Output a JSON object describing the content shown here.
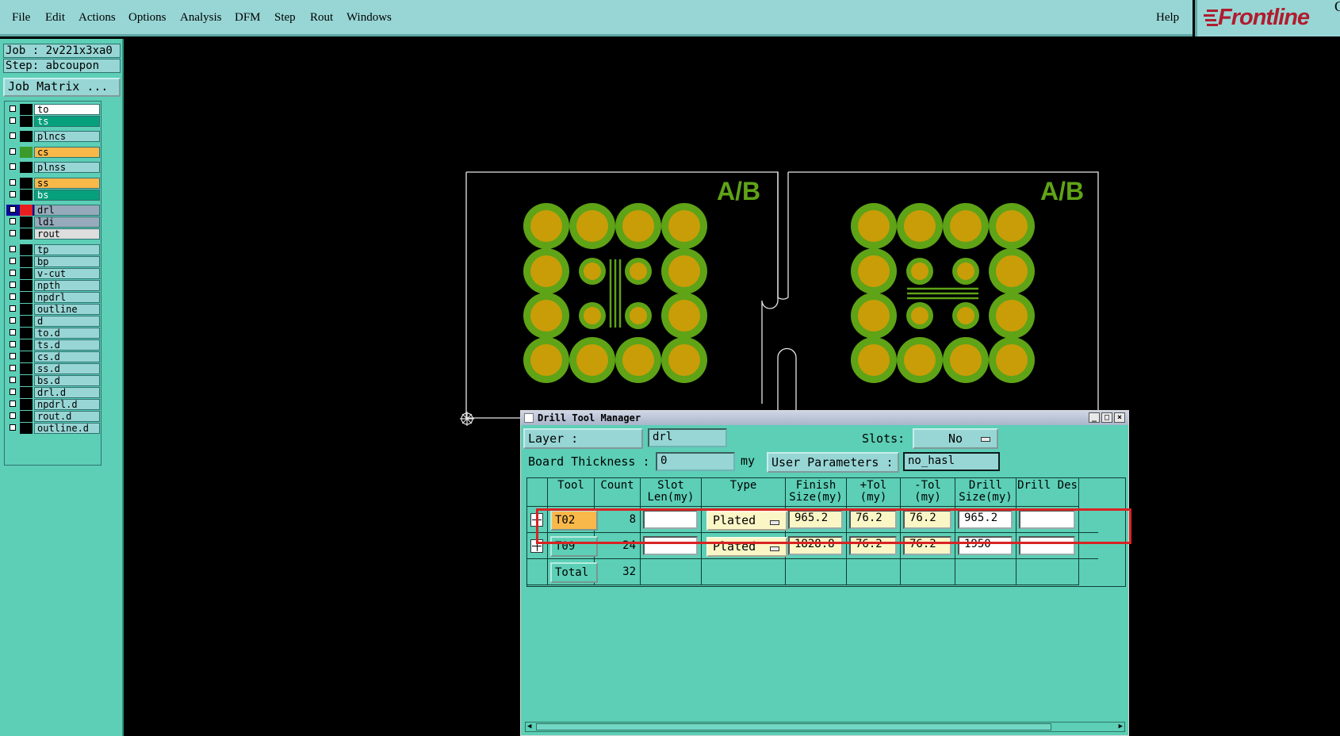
{
  "menubar": {
    "items": [
      "File",
      "Edit",
      "Actions",
      "Options",
      "Analysis",
      "DFM",
      "Step",
      "Rout",
      "Windows"
    ],
    "help": "Help",
    "logo": "Frontline",
    "logo_cut": "G"
  },
  "left_panel": {
    "job": "Job : 2v221x3xa0",
    "step": "Step: abcoupon",
    "job_matrix": "Job Matrix ...",
    "layers": [
      {
        "name": "to",
        "color": "#ffffff",
        "swatch": "#000000"
      },
      {
        "name": "ts",
        "color": "#06a07c",
        "swatch": "#000000"
      },
      {
        "name": "plncs",
        "color": "#97d6d5",
        "swatch": "#000000"
      },
      {
        "name": "cs",
        "color": "#f9b84a",
        "swatch": "#3c9a2a"
      },
      {
        "name": "plnss",
        "color": "#97d6d5",
        "swatch": "#000000"
      },
      {
        "name": "ss",
        "color": "#f9b84a",
        "swatch": "#000000"
      },
      {
        "name": "bs",
        "color": "#06a07c",
        "swatch": "#000000"
      },
      {
        "name": "drl",
        "color": "#97aabb",
        "swatch": "#e81e1e",
        "active": true
      },
      {
        "name": "ldi",
        "color": "#97aabb",
        "swatch": "#000000"
      },
      {
        "name": "rout",
        "color": "#dddddd",
        "swatch": "#000000"
      },
      {
        "name": "tp",
        "color": "#97d6d5",
        "swatch": "#000000"
      },
      {
        "name": "bp",
        "color": "#97d6d5",
        "swatch": "#000000"
      },
      {
        "name": "v-cut",
        "color": "#97d6d5",
        "swatch": "#000000"
      },
      {
        "name": "npth",
        "color": "#97d6d5",
        "swatch": "#000000"
      },
      {
        "name": "npdrl",
        "color": "#97d6d5",
        "swatch": "#000000"
      },
      {
        "name": "outline",
        "color": "#97d6d5",
        "swatch": "#000000"
      },
      {
        "name": "d",
        "color": "#97d6d5",
        "swatch": "#000000"
      },
      {
        "name": "to.d",
        "color": "#97d6d5",
        "swatch": "#000000"
      },
      {
        "name": "ts.d",
        "color": "#97d6d5",
        "swatch": "#000000"
      },
      {
        "name": "cs.d",
        "color": "#97d6d5",
        "swatch": "#000000"
      },
      {
        "name": "ss.d",
        "color": "#97d6d5",
        "swatch": "#000000"
      },
      {
        "name": "bs.d",
        "color": "#97d6d5",
        "swatch": "#000000"
      },
      {
        "name": "drl.d",
        "color": "#97d6d5",
        "swatch": "#000000"
      },
      {
        "name": "npdrl.d",
        "color": "#97d6d5",
        "swatch": "#000000"
      },
      {
        "name": "rout.d",
        "color": "#97d6d5",
        "swatch": "#000000"
      },
      {
        "name": "outline.d",
        "color": "#97d6d5",
        "swatch": "#000000"
      }
    ]
  },
  "canvas": {
    "label_left": "A/B",
    "label_right": "A/B",
    "pad_outer_color": "#5fa317",
    "pad_inner_color": "#c99d08"
  },
  "dialog": {
    "title": "Drill Tool Manager",
    "layer_label": "Layer                :",
    "layer_value": "drl",
    "slots_label": "Slots:",
    "slots_value": "No",
    "board_thickness_label": "Board Thickness :",
    "board_thickness_value": "0",
    "board_thickness_unit": "my",
    "user_params_label": "User Parameters :",
    "user_params_value": "no_hasl",
    "columns": [
      "",
      "Tool",
      "Count",
      "Slot Len(my)",
      "Type",
      "Finish Size(my)",
      "+Tol (my)",
      "-Tol (my)",
      "Drill Size(my)",
      "Drill Des"
    ],
    "rows": [
      {
        "tool": "T02",
        "count": "8",
        "slot_len": "",
        "type": "Plated",
        "finish": "965.2",
        "ptol": "76.2",
        "mtol": "76.2",
        "drill": "965.2",
        "des": "",
        "selected": true
      },
      {
        "tool": "T09",
        "count": "24",
        "slot_len": "",
        "type": "Plated",
        "finish": "1828.8",
        "ptol": "76.2",
        "mtol": "76.2",
        "drill": "1950",
        "des": "",
        "selected": false
      }
    ],
    "total_label": "Total",
    "total_count": "32"
  }
}
